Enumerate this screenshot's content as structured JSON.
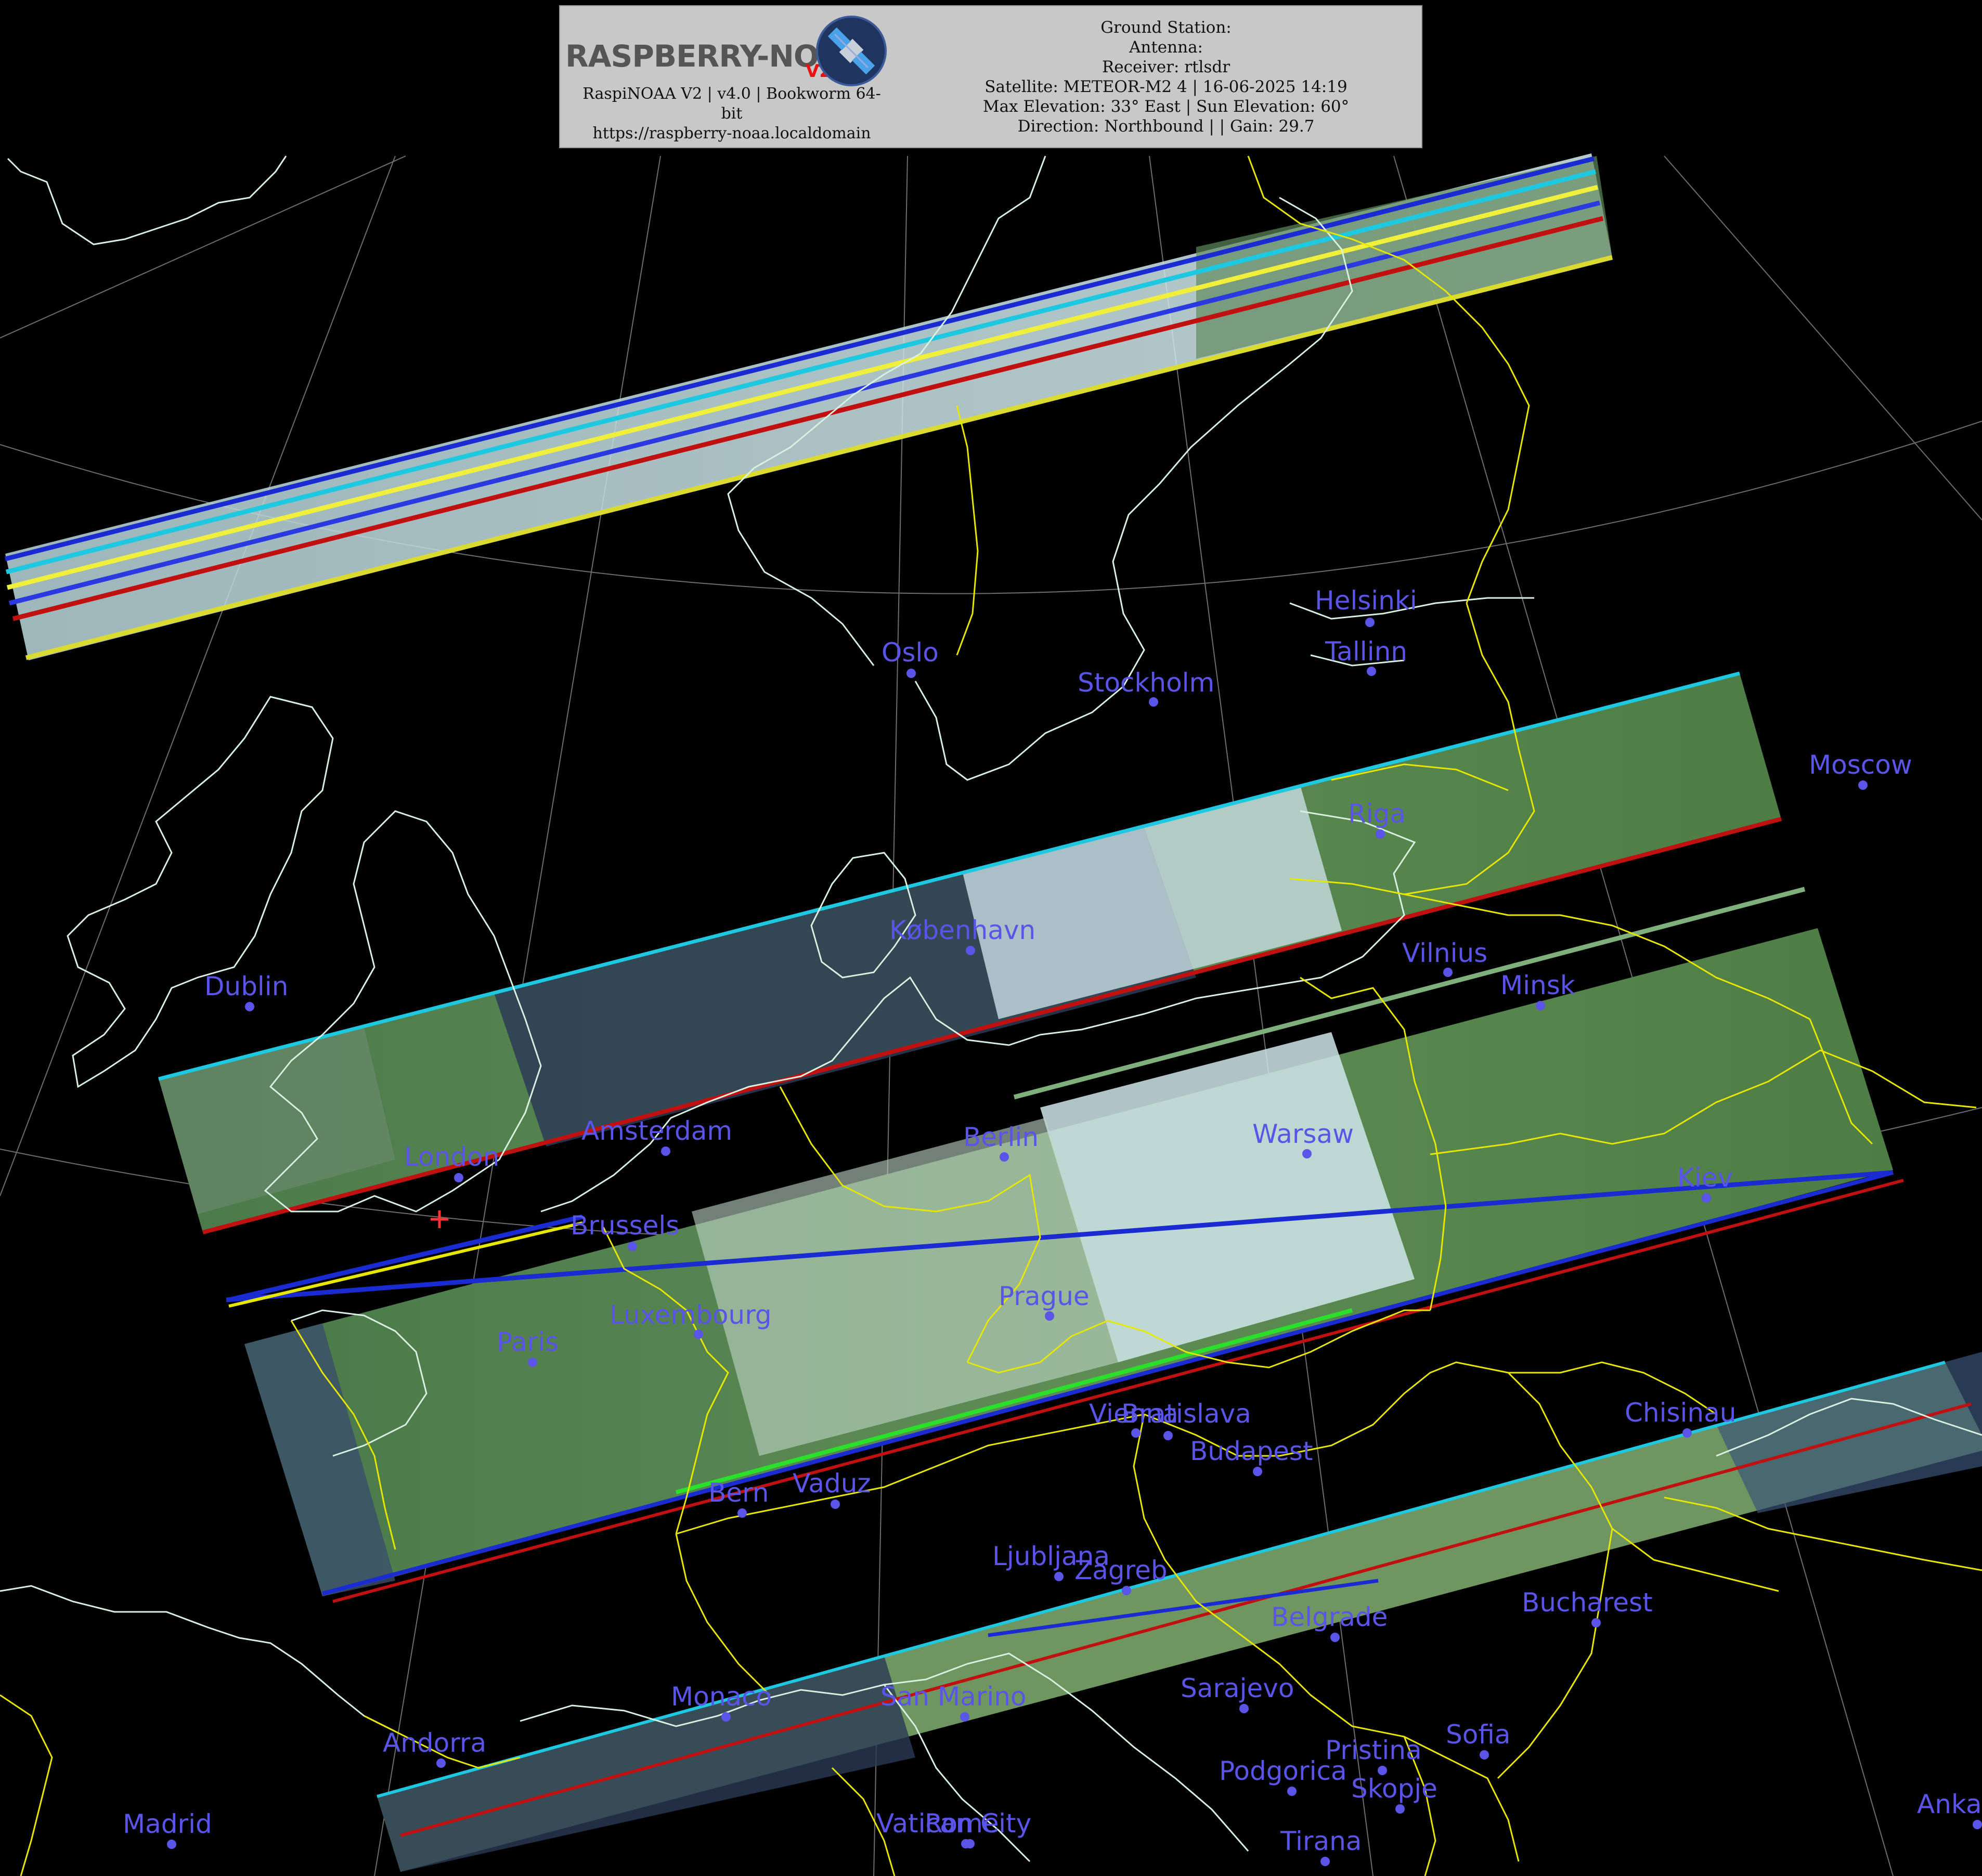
{
  "header": {
    "logo_text": "RASPBERRY-NOAA",
    "logo_version": "V2",
    "info_left": [
      "RaspiNOAA V2 | v4.0 | Bookworm 64-",
      "bit",
      "https://raspberry-noaa.localdomain"
    ],
    "info_right": [
      "Ground Station:",
      "Antenna:",
      "Receiver: rtlsdr",
      "Satellite: METEOR-M2 4 | 16-06-2025 14:19",
      "Max Elevation: 33° East | Sun Elevation: 60°",
      "Direction: Northbound | | Gain: 29.7"
    ]
  },
  "map": {
    "colors": {
      "background": "#000000",
      "coastline": "#d8f0e0",
      "borders": "#e6e600",
      "graticule": "#9a9a9a",
      "city": "#5b54e8",
      "marker": "#ff3333"
    },
    "cities": [
      {
        "name": "Oslo"
      },
      {
        "name": "Stockholm"
      },
      {
        "name": "Helsinki"
      },
      {
        "name": "Tallinn"
      },
      {
        "name": "Moscow"
      },
      {
        "name": "Riga"
      },
      {
        "name": "København"
      },
      {
        "name": "Vilnius"
      },
      {
        "name": "Minsk"
      },
      {
        "name": "Dublin"
      },
      {
        "name": "Amsterdam"
      },
      {
        "name": "London"
      },
      {
        "name": "Berlin"
      },
      {
        "name": "Warsaw"
      },
      {
        "name": "Kiev"
      },
      {
        "name": "Brussels"
      },
      {
        "name": "Luxembourg"
      },
      {
        "name": "Prague"
      },
      {
        "name": "Paris"
      },
      {
        "name": "Vienna"
      },
      {
        "name": "Bratislava"
      },
      {
        "name": "Budapest"
      },
      {
        "name": "Chisinau"
      },
      {
        "name": "Bern"
      },
      {
        "name": "Vaduz"
      },
      {
        "name": "Ljubljana"
      },
      {
        "name": "Zagreb"
      },
      {
        "name": "Belgrade"
      },
      {
        "name": "Bucharest"
      },
      {
        "name": "Monaco"
      },
      {
        "name": "San Marino"
      },
      {
        "name": "Sarajevo"
      },
      {
        "name": "Andorra"
      },
      {
        "name": "Pristina"
      },
      {
        "name": "Sofia"
      },
      {
        "name": "Podgorica"
      },
      {
        "name": "Skopje"
      },
      {
        "name": "Madrid"
      },
      {
        "name": "Vatican City"
      },
      {
        "name": "Rome"
      },
      {
        "name": "Tirana"
      },
      {
        "name": "Ankara"
      }
    ]
  }
}
